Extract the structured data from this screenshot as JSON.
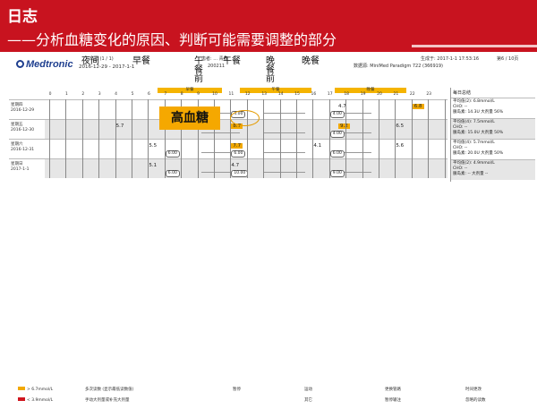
{
  "banner": {
    "title": "日志",
    "subtitle": "——分析血糖变化的原因、判断可能需要调整的部分"
  },
  "report": {
    "logo": "Medtronic",
    "title": "日志 (1 / 1)",
    "date_range": "2016-12-29 - 2017-1-1",
    "patient": "患者: ... 青春",
    "patient_id": "200211",
    "generated": "生成于: 2017-1-1 17:53:16",
    "page": "第6 / 10页",
    "device": "数据源: MiniMed Paradigm 722 (366919)"
  },
  "meal_labels": {
    "night": "夜间",
    "breakfast": "早餐",
    "pre_lunch": "午\n餐\n前",
    "lunch": "午餐",
    "pre_dinner": "晚\n餐\n前",
    "dinner": "晚餐"
  },
  "grid": {
    "hours": [
      "0",
      "1",
      "2",
      "3",
      "4",
      "5",
      "6",
      "7",
      "8",
      "9",
      "10",
      "11",
      "12",
      "13",
      "14",
      "15",
      "16",
      "17",
      "18",
      "19",
      "20",
      "21",
      "22",
      "23"
    ],
    "meal_headers": [
      "早餐",
      "午餐",
      "晚餐"
    ],
    "rows": [
      {
        "day": "星期四\n2016-12-29",
        "glucose": [
          {
            "hour": 17.5,
            "value": "4.7",
            "high": false
          },
          {
            "hour": 22,
            "value": "6.8",
            "high": true
          }
        ],
        "carbs": [
          {
            "hour": 11,
            "value": "4.00"
          },
          {
            "hour": 17,
            "value": "4.00"
          }
        ]
      },
      {
        "day": "星期五\n2016-12-30",
        "glucose": [
          {
            "hour": 4,
            "value": "5.7",
            "high": false
          },
          {
            "hour": 11,
            "value": "8.7",
            "high": true
          },
          {
            "hour": 17.5,
            "value": "9.2",
            "high": true
          },
          {
            "hour": 21,
            "value": "6.5",
            "high": false
          }
        ],
        "carbs": [
          {
            "hour": 17,
            "value": "4.00"
          }
        ]
      },
      {
        "day": "星期六\n2016-12-31",
        "glucose": [
          {
            "hour": 6,
            "value": "5.5",
            "high": false
          },
          {
            "hour": 11,
            "value": "7.7",
            "high": true
          },
          {
            "hour": 16,
            "value": "4.1",
            "high": false
          },
          {
            "hour": 21,
            "value": "5.6",
            "high": false
          }
        ],
        "carbs": [
          {
            "hour": 7,
            "value": "6.00"
          },
          {
            "hour": 11,
            "value": "6.00"
          },
          {
            "hour": 17,
            "value": "6.00"
          }
        ]
      },
      {
        "day": "星期日\n2017-1-1",
        "glucose": [
          {
            "hour": 6,
            "value": "5.1",
            "high": false
          },
          {
            "hour": 11,
            "value": "4.7",
            "high": false
          }
        ],
        "carbs": [
          {
            "hour": 7,
            "value": "6.00"
          },
          {
            "hour": 11,
            "value": "10.00"
          },
          {
            "hour": 17,
            "value": "9.00"
          }
        ]
      }
    ]
  },
  "stats": {
    "header": "每日总结",
    "blocks": [
      {
        "avg": "平均值(2):   6.8mmol/L",
        "cho": "CHO:   --",
        "insulin": "胰岛素:   14.3U 大剂量 56%"
      },
      {
        "avg": "平均值(4):   7.5mmol/L",
        "cho": "CHO:   --",
        "insulin": "胰岛素:   15.0U 大剂量 50%"
      },
      {
        "avg": "平均值(4):   5.7mmol/L",
        "cho": "CHO:   --",
        "insulin": "胰岛素:   20.0U 大剂量 50%"
      },
      {
        "avg": "平均值(2):   4.9mmol/L",
        "cho": "CHO:   --",
        "insulin": "胰岛素:   -- 大剂量 --"
      }
    ]
  },
  "callout": "高血糖",
  "legend": [
    {
      "text": "> 6.7mmol/L",
      "color": "#f2a900"
    },
    {
      "text": "< 3.9mmol/L",
      "color": "#d0161f"
    },
    {
      "text": "多次读数 (显示最低读数值)",
      "color": ""
    },
    {
      "text": "手动大剂量或补充大剂量",
      "color": ""
    },
    {
      "text": "暂停",
      "color": ""
    },
    {
      "text": "运动",
      "color": ""
    },
    {
      "text": "其它",
      "color": ""
    },
    {
      "text": "更换管路",
      "color": ""
    },
    {
      "text": "暂停输注",
      "color": ""
    },
    {
      "text": "时间更改",
      "color": ""
    },
    {
      "text": "忽略的读数",
      "color": ""
    }
  ],
  "colors": {
    "brand": "#c8131f",
    "high": "#f2a900",
    "low": "#d0161f"
  }
}
